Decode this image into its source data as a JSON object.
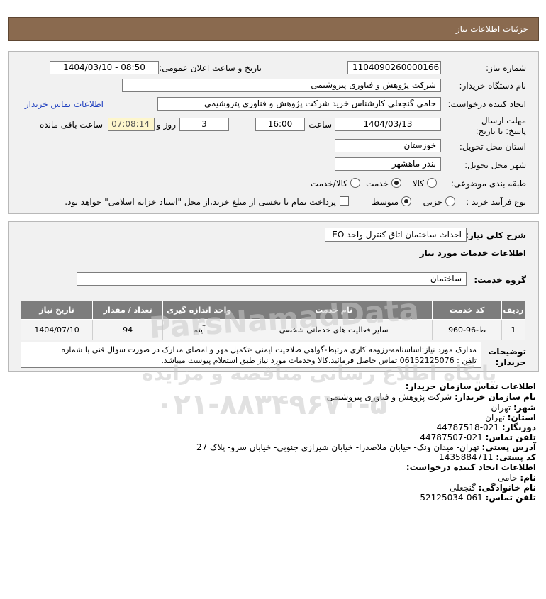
{
  "header": {
    "title": "جزئیات اطلاعات نیاز"
  },
  "form": {
    "need_number_label": "شماره نیاز:",
    "need_number": "1104090260000166",
    "announce_label": "تاریخ و ساعت اعلان عمومی:",
    "announce_value": "1404/03/10 - 08:50",
    "buyer_org_label": "نام دستگاه خریدار:",
    "buyer_org": "شرکت پژوهش و فناوری پتروشیمی",
    "creator_label": "ایجاد کننده درخواست:",
    "creator": "حامی گنجعلی کارشناس خرید شرکت پژوهش و فناوری پتروشیمی",
    "contact_link": "اطلاعات تماس خریدار",
    "deadline_label": "مهلت ارسال پاسخ: تا تاریخ:",
    "deadline_date": "1404/03/13",
    "time_label": "ساعت",
    "deadline_time": "16:00",
    "days_value": "3",
    "days_label": "روز و",
    "remaining_time": "07:08:14",
    "remaining_label": "ساعت باقی مانده",
    "province_label": "استان محل تحویل:",
    "province": "خوزستان",
    "city_label": "شهر محل تحویل:",
    "city": "بندر ماهشهر",
    "category_label": "طبقه بندی موضوعی:",
    "category_options": [
      "کالا",
      "خدمت",
      "کالا/خدمت"
    ],
    "category_selected": "خدمت",
    "process_label": "نوع فرآیند خرید :",
    "process_options": [
      "جزیی",
      "متوسط"
    ],
    "process_selected": "متوسط",
    "payment_note": "پرداخت تمام یا بخشی از مبلغ خرید،از محل \"اسناد خزانه اسلامی\" خواهد بود."
  },
  "summary": {
    "label": "شرح کلی نیاز:",
    "value": "احداث ساختمان اتاق کنترل واحد EO",
    "services_heading": "اطلاعات خدمات مورد نیاز",
    "group_label": "گروه خدمت:",
    "group_value": "ساختمان"
  },
  "table": {
    "headers": [
      "ردیف",
      "کد خدمت",
      "نام خدمت",
      "واحد اندازه گیری",
      "تعداد / مقدار",
      "تاریخ نیاز"
    ],
    "rows": [
      [
        "1",
        "ط-96-960",
        "سایر فعالیت های خدماتی شخصی",
        "آیتم",
        "94",
        "1404/07/10"
      ]
    ]
  },
  "notes": {
    "label": "توضیحات خریدار:",
    "line1": "مدارک مورد نیاز:اساسنامه-رزومه کاری مرتبط-گواهی صلاحیت ایمنی -تکمیل مهر و امضای مدارک در صورت سوال فنی با شماره",
    "line2": "تلفن : 06152125076 تماس حاصل فرمائید.کالا وخدمات مورد نیاز طبق استعلام پیوست میباشد."
  },
  "contact": {
    "heading": "اطلاعات تماس سازمان خریدار:",
    "org_label": "نام سازمان خریدار:",
    "org_value": "شرکت پژوهش و فناوری پتروشیمی",
    "city_label": "شهر:",
    "city_value": "تهران",
    "province_label": "استان:",
    "province_value": "تهران",
    "fax_label": "دورنگار:",
    "fax_value": "021-44787518",
    "phone_label": "تلفن تماس:",
    "phone_value": "021-44787507",
    "address_label": "آدرس پستی:",
    "address_value": "تهران- میدان ونک- خیابان ملاصدرا- خیابان شیرازی جنوبی- خیابان سرو- پلاک 27",
    "postal_label": "کد پستی:",
    "postal_value": "1435884711",
    "creator_heading": "اطلاعات ایجاد کننده درخواست:",
    "name_label": "نام:",
    "name_value": "حامی",
    "family_label": "نام خانوادگی:",
    "family_value": "گنجعلی",
    "creator_phone_label": "تلفن تماس:",
    "creator_phone_value": "061-52125034"
  },
  "watermark": {
    "name": "ParsNamadData",
    "tagline": "پایگاه اطلاع رسانی مناقصه و مزایده",
    "phone": "۰۲۱-۸۸۳۴۹۶۷۰-۵"
  }
}
